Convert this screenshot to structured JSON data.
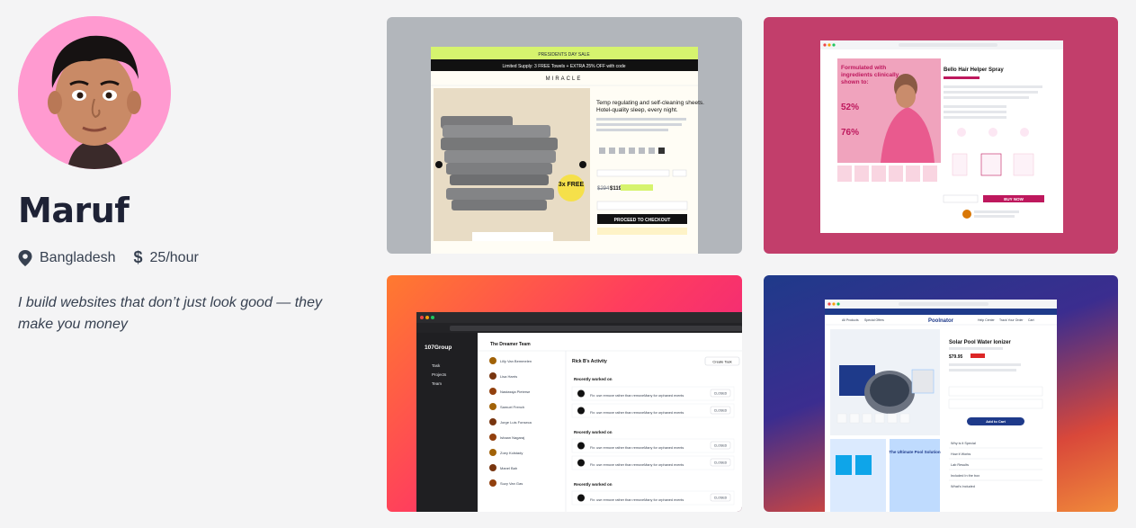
{
  "profile": {
    "name": "Maruf",
    "location": "Bangladesh",
    "rate": "25/hour",
    "tagline": "I build websites that don’t just look good — they make you money"
  },
  "projects": [
    {
      "id": "miracle",
      "banner_top": "PRESIDENTS DAY SALE",
      "banner_sub": "Limited Supply: 3 FREE Towels + EXTRA 25% OFF with code",
      "brand": "MIRACLE",
      "heading": "Temp regulating and self-cleaning sheets. Hotel-quality sleep, every night.",
      "badge": "3x FREE",
      "price_old": "$294",
      "price_new": "$119",
      "cta": "PROCEED TO CHECKOUT"
    },
    {
      "id": "bello",
      "headline": "Formulated with ingredients clinically shown to:",
      "stat1": "52%",
      "stat2": "76%",
      "product_title": "Bello Hair Helper Spray",
      "cta": "BUY NOW"
    },
    {
      "id": "dreamer",
      "brand": "107Group",
      "nav": [
        "Task",
        "Projects",
        "Team"
      ],
      "team_title": "The Dreamer Team",
      "activity_title": "Rick B's Activity",
      "create_button": "Create Task",
      "members": [
        "Lilly Van Bemmelen",
        "Lisa Harris",
        "Nastassja Pieterse",
        "Samuel French",
        "Jorge Luis Fonseca",
        "Ishaan Nagaraj",
        "Zoey Kolstady",
        "Manel Bah",
        "Suzy Van Gas"
      ],
      "section_label": "Recently worked on",
      "row_text": "Fix: use remove rather than removeMany for orphaned events",
      "row_status": "CLOSED"
    },
    {
      "id": "poolnator",
      "brand": "Poolnator",
      "nav": [
        "All Products",
        "Special Offers",
        "Help Center",
        "Track Your Order",
        "Cart"
      ],
      "product_title": "Solar Pool Water Ionizer",
      "price": "$79.95",
      "cta": "Add to Cart",
      "side_banner": "The Ultimate Pool Solution",
      "faq": [
        "Why is it Special",
        "How it Works",
        "Lab Results",
        "Included In the box",
        "What's Included"
      ]
    }
  ]
}
